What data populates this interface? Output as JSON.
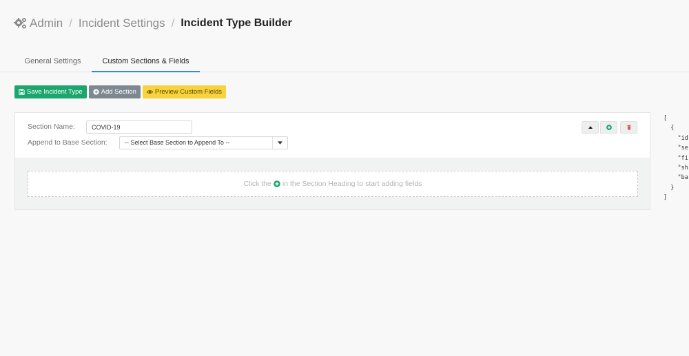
{
  "breadcrumb": {
    "icon": "gears-icon",
    "items": [
      "Admin",
      "Incident Settings"
    ],
    "separator": "/",
    "current": "Incident Type Builder"
  },
  "tabs": [
    {
      "label": "General Settings",
      "active": false
    },
    {
      "label": "Custom Sections & Fields",
      "active": true
    }
  ],
  "toolbar": {
    "save_label": "Save Incident Type",
    "add_label": "Add Section",
    "preview_label": "Preview Custom Fields"
  },
  "section": {
    "name_label": "Section Name:",
    "name_value": "COVID-19",
    "append_label": "Append to Base Section:",
    "append_selected": "-- Select Base Section to Append To --",
    "empty_text_before": "Click the",
    "empty_text_after": "in the Section Heading to start adding fields"
  },
  "json_preview": "[\n  {\n    \"id\n    \"se\n    \"fi\n    \"sh\n    \"ba\n  }\n]",
  "colors": {
    "save": "#1aa66d",
    "add": "#7d8891",
    "preview": "#f8d33d",
    "tab_active": "#2e8fd6",
    "delete": "#d9534f"
  }
}
